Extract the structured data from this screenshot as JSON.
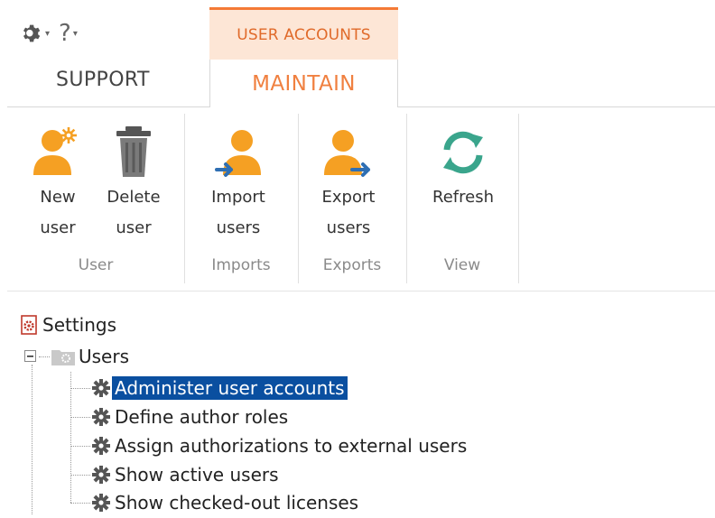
{
  "quick_tools": {
    "settings_icon": "gear-icon",
    "help_label": "?"
  },
  "ribbon": {
    "context_header": "USER ACCOUNTS",
    "tabs": [
      {
        "label": "SUPPORT",
        "active": false
      },
      {
        "label": "MAINTAIN",
        "active": true
      }
    ],
    "groups": [
      {
        "label": "User",
        "buttons": [
          {
            "label": "New\nuser",
            "icon": "new-user-icon"
          },
          {
            "label": "Delete\nuser",
            "icon": "trash-icon"
          }
        ]
      },
      {
        "label": "Imports",
        "buttons": [
          {
            "label": "Import\nusers",
            "icon": "import-users-icon"
          }
        ]
      },
      {
        "label": "Exports",
        "buttons": [
          {
            "label": "Export\nusers",
            "icon": "export-users-icon"
          }
        ]
      },
      {
        "label": "View",
        "buttons": [
          {
            "label": "Refresh",
            "icon": "refresh-icon"
          }
        ]
      }
    ],
    "colors": {
      "accent": "#f47a36",
      "user_icon": "#f5a023",
      "refresh_icon": "#3aa58c",
      "selection": "#0a4fa0"
    }
  },
  "tree": {
    "root": "Settings",
    "node": "Users",
    "items": [
      {
        "label": "Administer user accounts",
        "selected": true
      },
      {
        "label": "Define author roles",
        "selected": false
      },
      {
        "label": "Assign authorizations to external users",
        "selected": false
      },
      {
        "label": "Show active users",
        "selected": false
      },
      {
        "label": "Show checked-out licenses",
        "selected": false
      }
    ]
  }
}
